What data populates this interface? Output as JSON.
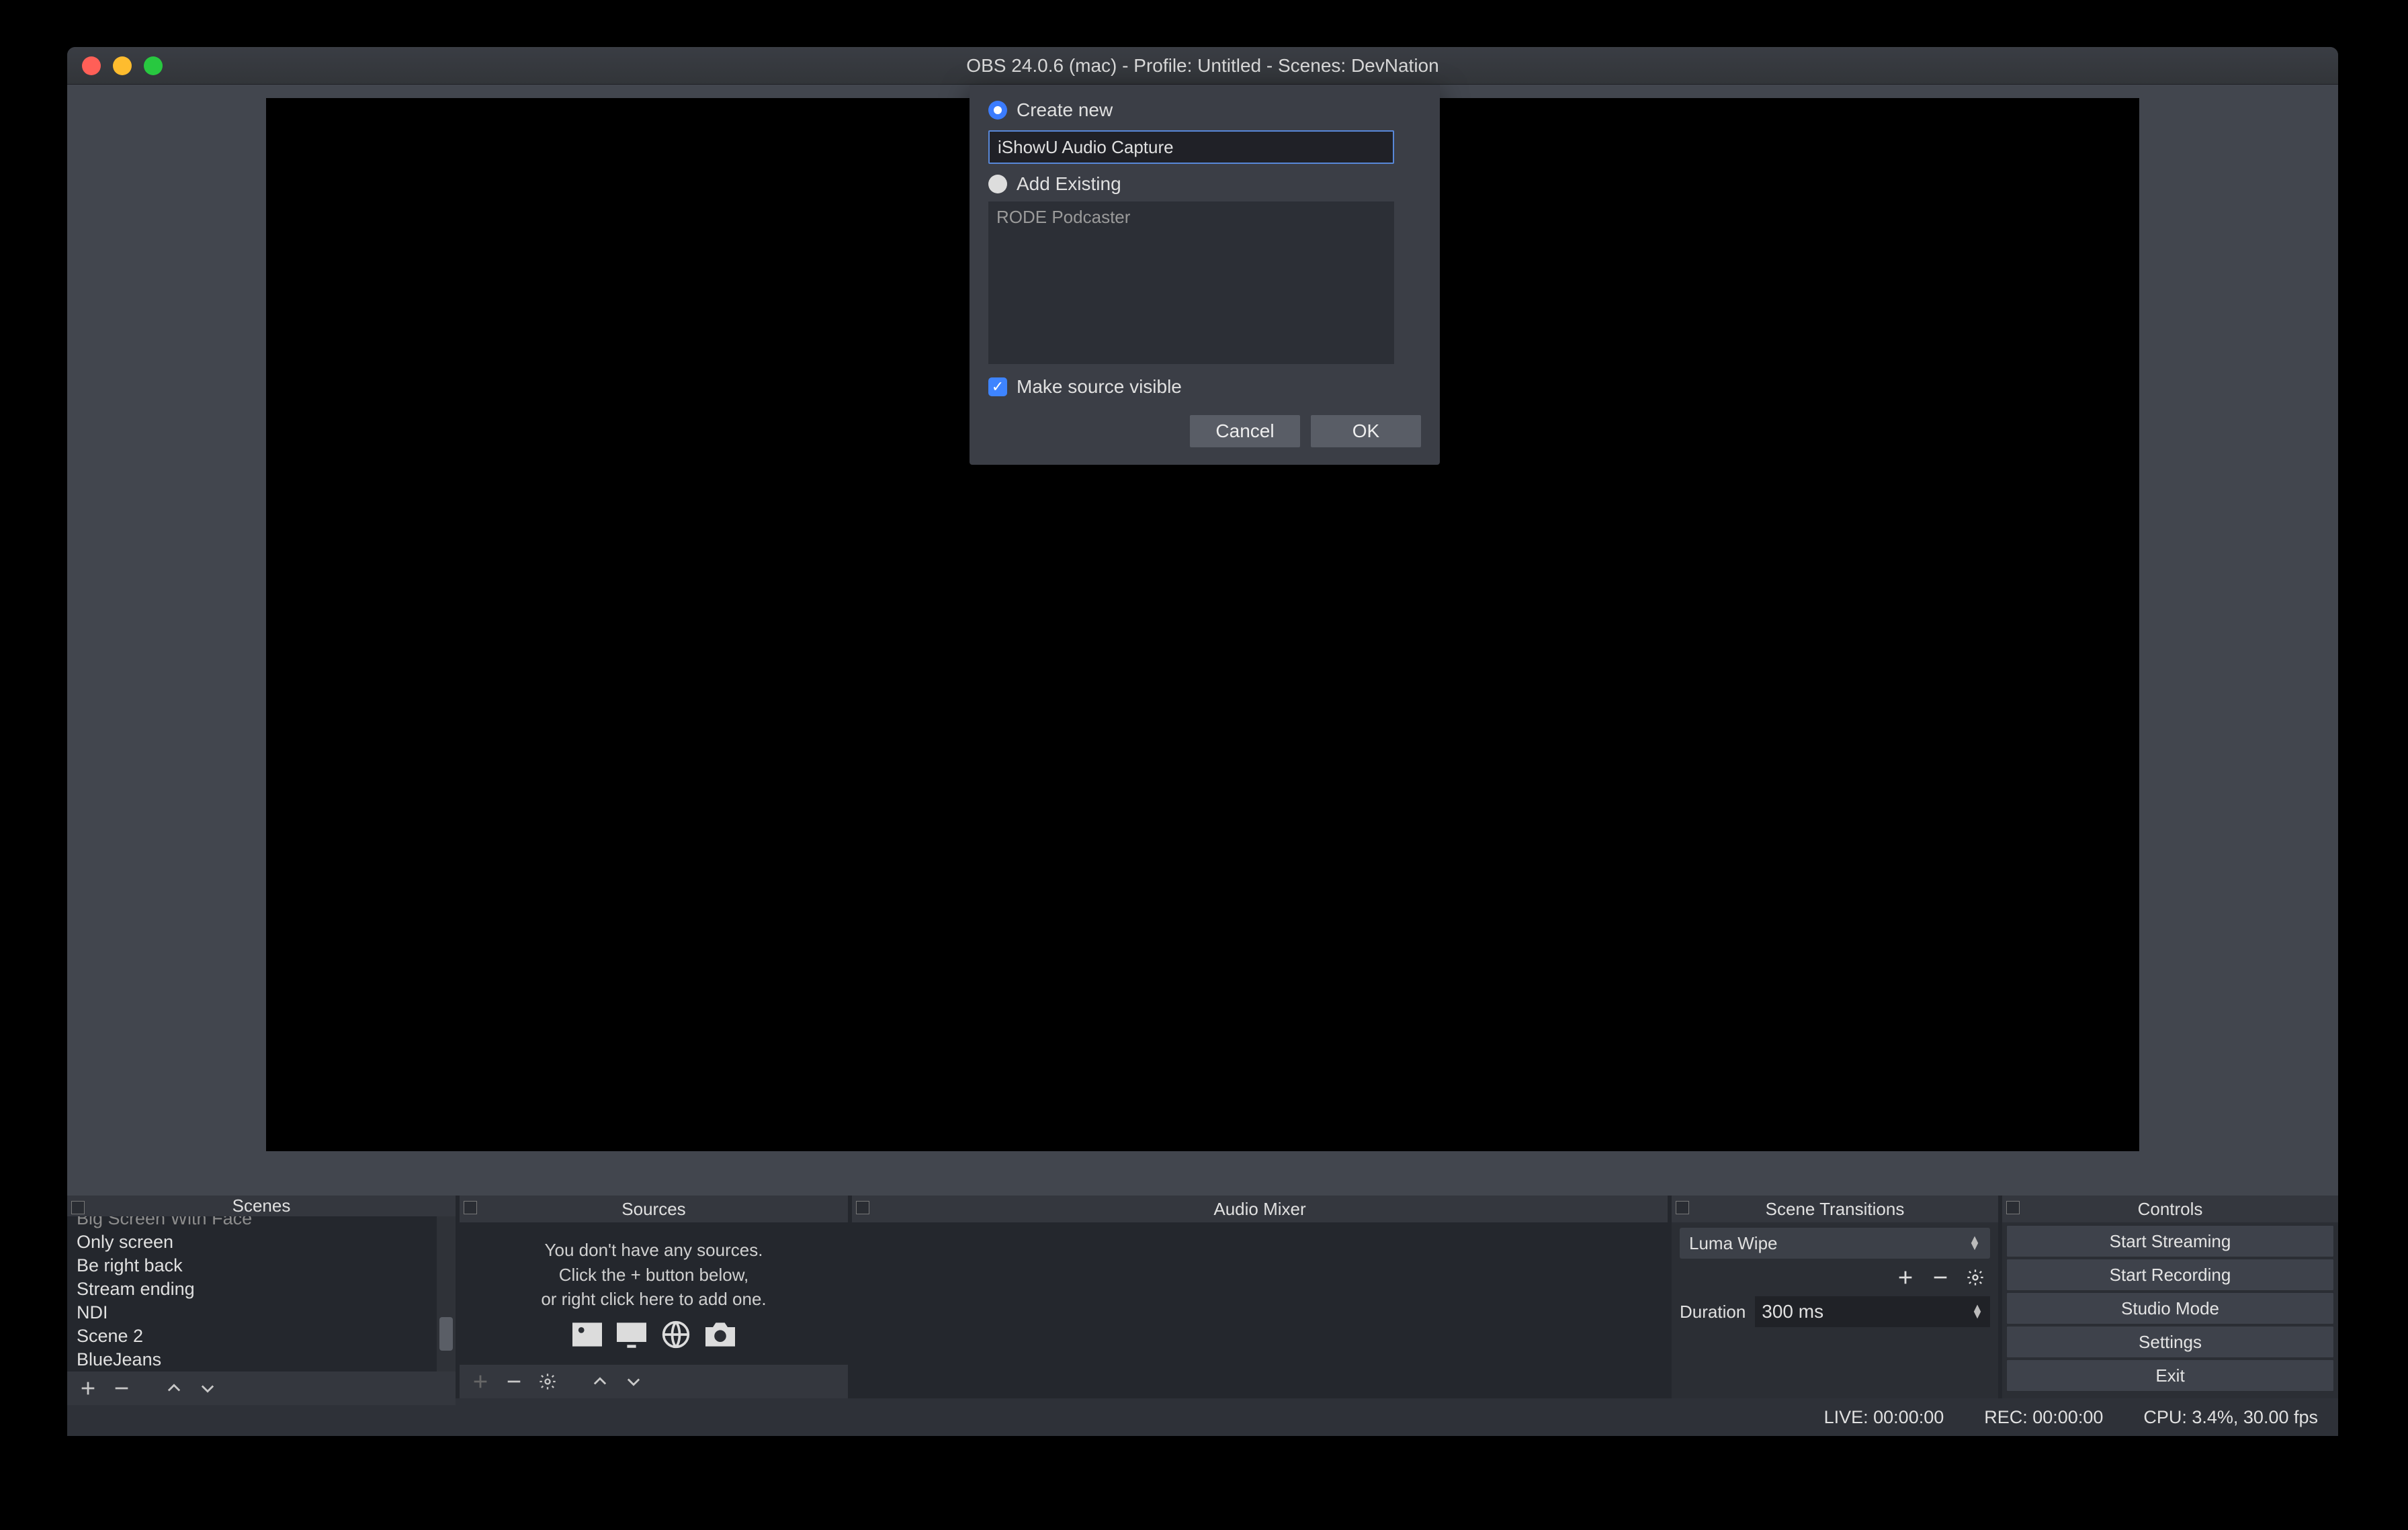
{
  "window": {
    "title": "OBS 24.0.6 (mac) - Profile: Untitled - Scenes: DevNation",
    "traffic": {
      "close": "#ff5f57",
      "min": "#febc2e",
      "max": "#28c840"
    }
  },
  "dialog": {
    "create_new": "Create new",
    "name_value": "iShowU Audio Capture",
    "add_existing": "Add Existing",
    "existing_items": [
      "RODE Podcaster"
    ],
    "make_visible": "Make source visible",
    "make_visible_checked": true,
    "cancel": "Cancel",
    "ok": "OK"
  },
  "panels": {
    "scenes": {
      "title": "Scenes",
      "items": [
        "Big Screen With Face",
        "Only screen",
        "Be right back",
        "Stream ending",
        "NDI",
        "Scene 2",
        "BlueJeans"
      ]
    },
    "sources": {
      "title": "Sources",
      "empty_line1": "You don't have any sources.",
      "empty_line2": "Click the + button below,",
      "empty_line3": "or right click here to add one."
    },
    "mixer": {
      "title": "Audio Mixer"
    },
    "transitions": {
      "title": "Scene Transitions",
      "selected": "Luma Wipe",
      "duration_label": "Duration",
      "duration_value": "300 ms"
    },
    "controls": {
      "title": "Controls",
      "buttons": [
        "Start Streaming",
        "Start Recording",
        "Studio Mode",
        "Settings",
        "Exit"
      ]
    }
  },
  "status": {
    "live": "LIVE: 00:00:00",
    "rec": "REC: 00:00:00",
    "cpu": "CPU: 3.4%, 30.00 fps"
  },
  "colors": {
    "accent": "#3b7cff"
  }
}
